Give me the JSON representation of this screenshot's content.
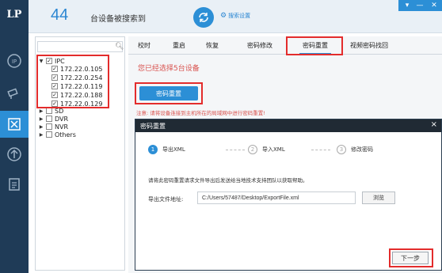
{
  "app": {
    "logo": "LP"
  },
  "header": {
    "count": "44",
    "found_text": "台设备被搜索到",
    "search_settings": "搜索设置"
  },
  "tree": {
    "search_placeholder": "",
    "root": "IPC",
    "ips": [
      "172.22.0.105",
      "172.22.0.254",
      "172.22.0.119",
      "172.22.0.188",
      "172.22.0.129"
    ],
    "others": [
      "SD",
      "DVR",
      "NVR",
      "Others"
    ]
  },
  "tabs": [
    "校时",
    "重启",
    "恢复",
    "密码修改",
    "密码重置",
    "视频密码找回"
  ],
  "active_tab": "密码重置",
  "main": {
    "selected_info": "您已经选择5台设备",
    "reset_button": "密码重置",
    "note": "注意: 请将设备连接到主机所在的局域网中进行密码重置!"
  },
  "dialog": {
    "title": "密码重置",
    "close": "×",
    "steps": [
      {
        "num": "1",
        "label": "导出XML"
      },
      {
        "num": "2",
        "label": "导入XML"
      },
      {
        "num": "3",
        "label": "修改密码"
      }
    ],
    "instruction": "请将此密码重置请求文件导出后发送给当地技术支持团队以获取帮助。",
    "path_label": "导出文件地址:",
    "path_value": "C:/Users/57487/Desktop/ExportFile.xml",
    "browse_button": "浏览",
    "next_button": "下一步"
  },
  "colors": {
    "accent": "#2c8fd6",
    "rail": "#1f3b57",
    "warning": "#d9534f",
    "highlight": "#e32c2c"
  }
}
